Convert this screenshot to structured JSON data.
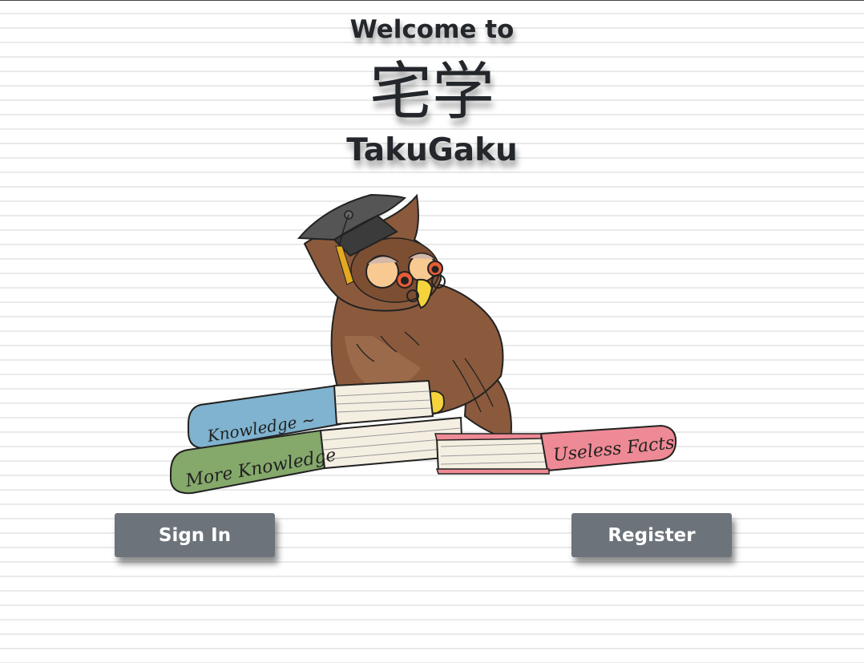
{
  "header": {
    "welcome": "Welcome to",
    "kanji": "宅学",
    "brand": "TakuGaku"
  },
  "illustration": {
    "books": {
      "top": "Knowledge",
      "middle": "More Knowledge",
      "right": "Useless Facts"
    }
  },
  "buttons": {
    "sign_in": "Sign In",
    "register": "Register"
  },
  "colors": {
    "button_bg": "#6c737a",
    "text_dark": "#23272b",
    "book_blue": "#7fb3cf",
    "book_green": "#85a86b",
    "book_pink": "#ee8a95",
    "owl_brown": "#8b5a3c"
  }
}
